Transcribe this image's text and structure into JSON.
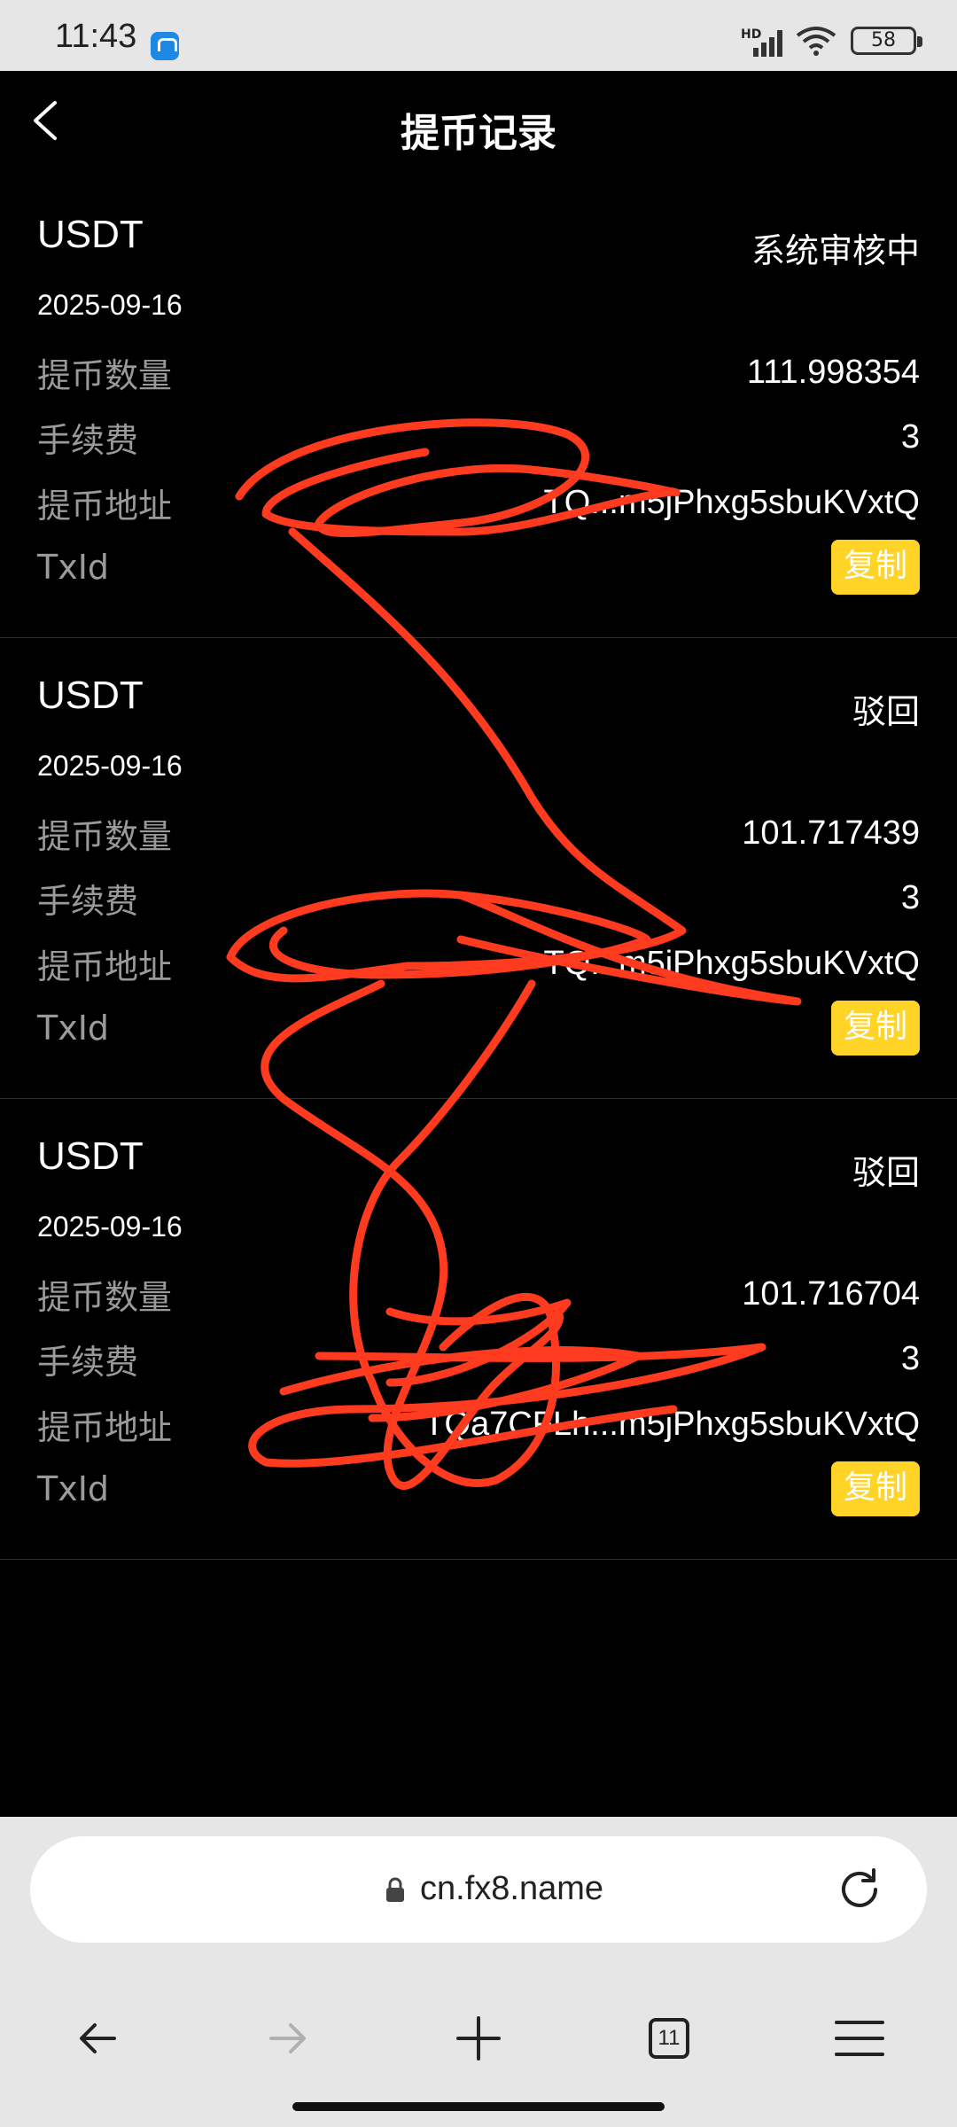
{
  "status_bar": {
    "time": "11:43",
    "network": "HD",
    "battery": "58"
  },
  "header": {
    "title": "提币记录"
  },
  "records": [
    {
      "coin": "USDT",
      "status": "系统审核中",
      "date": "2025-09-16",
      "amount_label": "提币数量",
      "amount": "111.998354",
      "fee_label": "手续费",
      "fee": "3",
      "address_label": "提币地址",
      "address": "TQ...m5jPhxg5sbuKVxtQ",
      "txid_label": "TxId",
      "copy_label": "复制"
    },
    {
      "coin": "USDT",
      "status": "驳回",
      "date": "2025-09-16",
      "amount_label": "提币数量",
      "amount": "101.717439",
      "fee_label": "手续费",
      "fee": "3",
      "address_label": "提币地址",
      "address": "TQ...m5jPhxg5sbuKVxtQ",
      "txid_label": "TxId",
      "copy_label": "复制"
    },
    {
      "coin": "USDT",
      "status": "驳回",
      "date": "2025-09-16",
      "amount_label": "提币数量",
      "amount": "101.716704",
      "fee_label": "手续费",
      "fee": "3",
      "address_label": "提币地址",
      "address": "TQa7CFLh...m5jPhxg5sbuKVxtQ",
      "txid_label": "TxId",
      "copy_label": "复制"
    }
  ],
  "browser": {
    "url": "cn.fx8.name",
    "tab_count": "11"
  },
  "colors": {
    "accent": "#ffd426",
    "scribble": "#ff3b1f"
  }
}
